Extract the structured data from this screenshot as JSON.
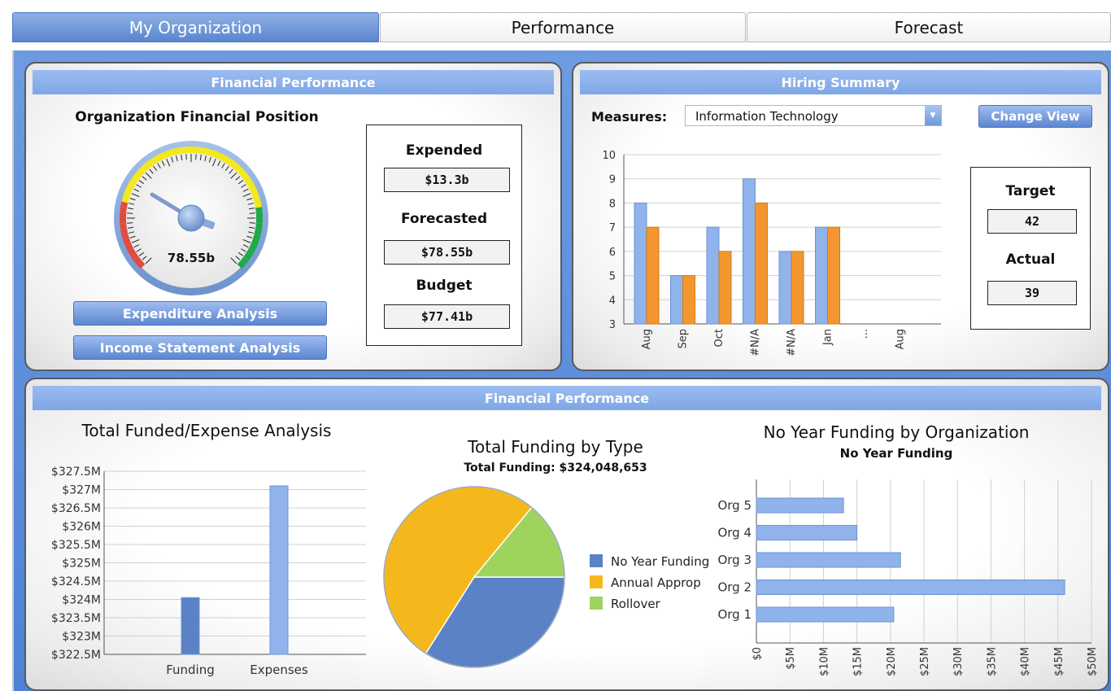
{
  "tabs": [
    {
      "label": "My Organization",
      "active": true
    },
    {
      "label": "Performance",
      "active": false
    },
    {
      "label": "Forecast",
      "active": false
    }
  ],
  "financial_panel": {
    "header": "Financial Performance",
    "title": "Organization Financial Position",
    "gauge_value": "78.55b",
    "expended_label": "Expended",
    "expended_value": "$13.3b",
    "forecasted_label": "Forecasted",
    "forecasted_value": "$78.55b",
    "budget_label": "Budget",
    "budget_value": "$77.41b",
    "btn_expenditure": "Expenditure Analysis",
    "btn_income": "Income Statement Analysis"
  },
  "hiring_panel": {
    "header": "Hiring Summary",
    "measures_label": "Measures:",
    "measures_value": "Information Technology",
    "change_view": "Change View",
    "target_label": "Target",
    "target_value": "42",
    "actual_label": "Actual",
    "actual_value": "39"
  },
  "bottom_panel": {
    "header": "Financial Performance"
  },
  "colors": {
    "blue_series": "#8fb3ea",
    "orange_series": "#f3962f",
    "pie_blue": "#5b82c6",
    "pie_yellow": "#f5b81c",
    "pie_green": "#9ed35e"
  },
  "chart_data": [
    {
      "id": "hiring",
      "type": "bar",
      "categories": [
        "Aug",
        "Sep",
        "Oct",
        "#N/A",
        "#N/A",
        "Jan",
        "...",
        "Aug"
      ],
      "series": [
        {
          "values": [
            8,
            5,
            7,
            9,
            6,
            7,
            null,
            null
          ]
        },
        {
          "values": [
            7,
            5,
            6,
            8,
            6,
            7,
            null,
            null
          ]
        }
      ],
      "ylim": [
        3,
        10
      ],
      "yticks": [
        "3",
        "4",
        "5",
        "6",
        "7",
        "8",
        "9",
        "10"
      ],
      "grid": true
    },
    {
      "id": "funded_expense",
      "type": "bar",
      "title": "Total Funded/Expense Analysis",
      "categories": [
        "Funding",
        "Expenses"
      ],
      "values": [
        324.05,
        327.1
      ],
      "ylim": [
        322.5,
        327.5
      ],
      "yticks": [
        "$322.5M",
        "$323M",
        "$323.5M",
        "$324M",
        "$324.5M",
        "$325M",
        "$325.5M",
        "$326M",
        "$326.5M",
        "$327M",
        "$327.5M"
      ],
      "grid": true
    },
    {
      "id": "funding_type",
      "type": "pie",
      "title": "Total Funding by Type",
      "subtitle": "Total Funding: $324,048,653",
      "labels": [
        "No Year Funding",
        "Annual Approp",
        "Rollover"
      ],
      "values": [
        34,
        52,
        14
      ],
      "legend": "right"
    },
    {
      "id": "no_year_org",
      "type": "bar",
      "orientation": "horizontal",
      "title": "No Year Funding by Organization",
      "subtitle": "No Year Funding",
      "categories": [
        "Org 5",
        "Org 4",
        "Org 3",
        "Org 2",
        "Org 1"
      ],
      "values": [
        13,
        15,
        21.5,
        46,
        20.5
      ],
      "xlim": [
        0,
        50
      ],
      "xticks": [
        "$0",
        "$5M",
        "$10M",
        "$15M",
        "$20M",
        "$25M",
        "$30M",
        "$35M",
        "$40M",
        "$45M",
        "$50M"
      ],
      "grid": true
    }
  ]
}
